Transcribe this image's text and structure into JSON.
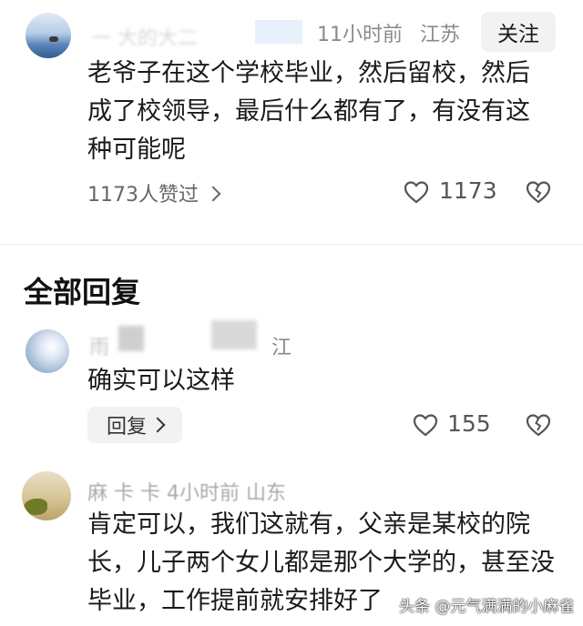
{
  "comment1": {
    "author": "一 大的大二",
    "time": "11小时前",
    "location": "江苏",
    "follow_label": "关注",
    "text": "老爷子在这个学校毕业，然后留校，然后成了校领导，最后什么都有了，有没有这种可能呢",
    "likers_label": "1173人赞过",
    "like_count": "1173"
  },
  "replies_section": {
    "title": "全部回复"
  },
  "reply1": {
    "author": "雨",
    "location": "江",
    "text": "确实可以这样",
    "reply_label": "回复",
    "like_count": "155"
  },
  "reply2": {
    "meta": "麻 卡 卡  4小时前  山东",
    "text": "肯定可以，我们这就有，父亲是某校的院长，儿子两个女儿都是那个大学的，甚至没毕业，工作提前就安排好了"
  },
  "watermark": "头条 @元气满满的小麻雀",
  "icons": {
    "like": "heart-icon",
    "dislike": "broken-heart-icon",
    "more": "chevron-right-icon"
  }
}
